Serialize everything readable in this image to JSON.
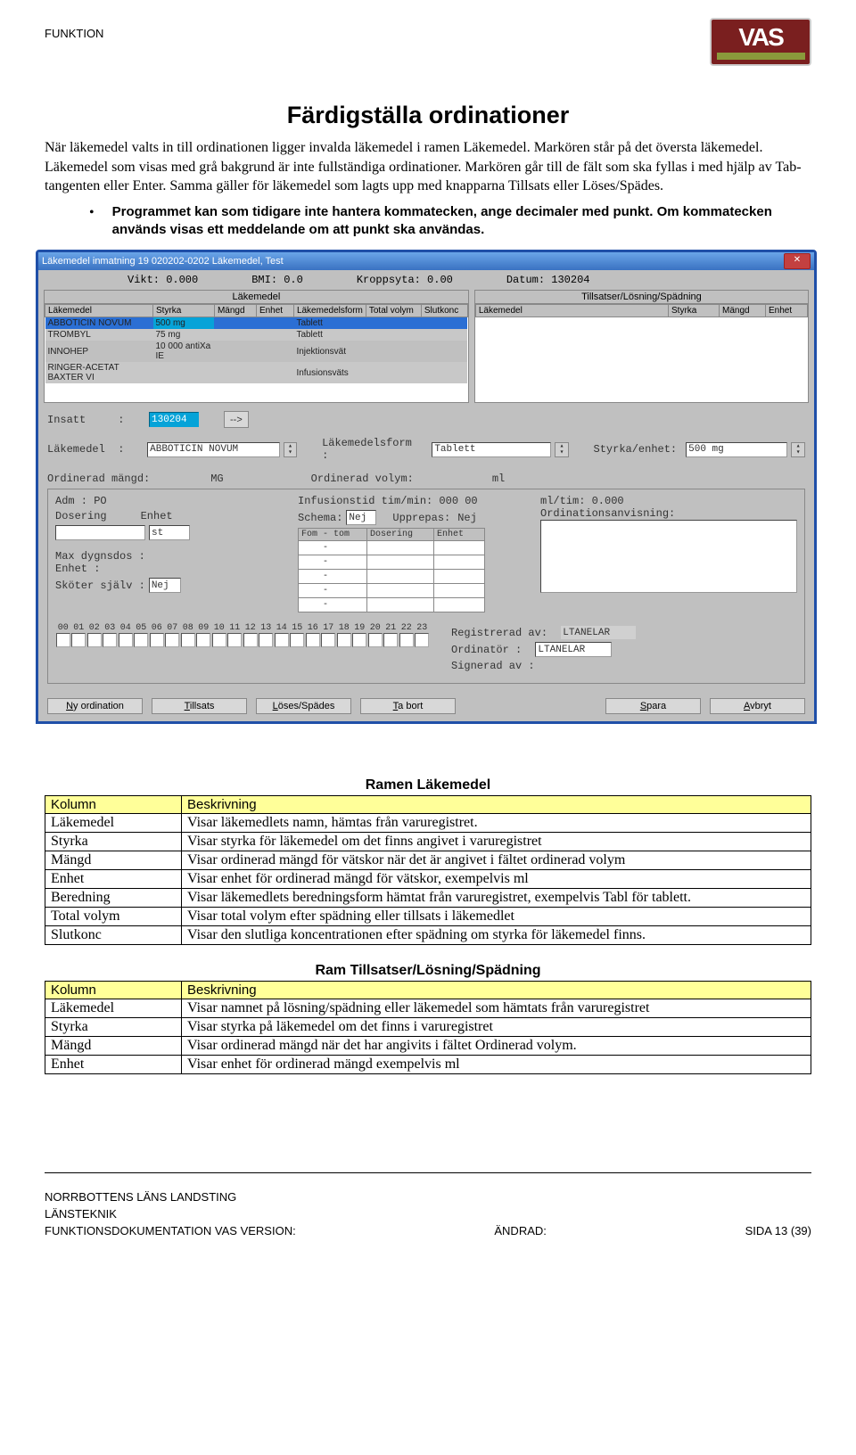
{
  "header": {
    "funktion": "FUNKTION",
    "logo_main": "VAS"
  },
  "title": "Färdigställa ordinationer",
  "intro": [
    "När läkemedel valts in till ordinationen ligger invalda läkemedel i ramen Läkemedel. Markören står på det översta läkemedel. Läkemedel som visas med grå bakgrund är inte fullständiga ordinationer. Markören går till de fält som ska fyllas i med hjälp av Tab-tangenten eller Enter. Samma gäller för läkemedel som lagts upp med knapparna Tillsats eller Löses/Spädes."
  ],
  "bullet": "Programmet kan som tidigare inte hantera kommatecken, ange decimaler med punkt. Om kommatecken används visas ett meddelande om att punkt ska användas.",
  "win": {
    "title": "Läkemedel inmatning  19 020202-0202  Läkemedel, Test",
    "status": {
      "vikt": "Vikt: 0.000",
      "bmi": "BMI: 0.0",
      "kropp": "Kroppsyta: 0.00",
      "datum": "Datum: 130204"
    },
    "pane_left_title": "Läkemedel",
    "pane_right_title": "Tillsatser/Lösning/Spädning",
    "cols_left": [
      "Läkemedel",
      "Styrka",
      "Mängd",
      "Enhet",
      "Läkemedelsform",
      "Total volym",
      "Slutkonc"
    ],
    "cols_right": [
      "Läkemedel",
      "Styrka",
      "Mängd",
      "Enhet"
    ],
    "rows": [
      {
        "n": "ABBOTICIN NOVUM",
        "s": "500 mg",
        "form": "Tablett",
        "sel": true
      },
      {
        "n": "TROMBYL",
        "s": "75 mg",
        "form": "Tablett"
      },
      {
        "n": "INNOHEP",
        "s": "10 000 antiXa IE",
        "form": "Injektionsvät"
      },
      {
        "n": "RINGER-ACETAT BAXTER VI",
        "s": "",
        "form": "Infusionsväts"
      }
    ],
    "form": {
      "insatt_lbl": "Insatt",
      "insatt_val": "130204",
      "arrow": "-->",
      "lakemedel_lbl": "Läkemedel",
      "lakemedel_val": "ABBOTICIN NOVUM",
      "lakform_lbl": "Läkemedelsform :",
      "lakform_val": "Tablett",
      "styrka_lbl": "Styrka/enhet:",
      "styrka_val": "500 mg",
      "ord_mangd_lbl": "Ordinerad mängd:",
      "mg": "MG",
      "ord_vol_lbl": "Ordinerad volym:",
      "ml": "ml",
      "adm": "Adm   : PO",
      "infustid": "Infusionstid tim/min: 000 00",
      "mltim": "ml/tim:    0.000",
      "dosering": "Dosering",
      "enhet": "Enhet",
      "st": "st",
      "schema": "Schema:",
      "nej": "Nej",
      "upprepas": "Upprepas:",
      "ordanv": "Ordinationsanvisning:",
      "fomtom": "Fom - tom",
      "dos": "Dosering",
      "enh": "Enhet",
      "maxd": "Max dygnsdos  :",
      "enhlbl": "Enhet         :",
      "skoter": "Sköter själv  :",
      "reg": "Registrerad av:",
      "reg_v": "LTANELAR",
      "ordb": "Ordinatör     :",
      "ord_v": "LTANELAR",
      "sig": "Signerad av   :"
    },
    "buttons": [
      "Ny ordination",
      "Tillsats",
      "Löses/Spädes",
      "Ta bort",
      "Spara",
      "Avbryt"
    ]
  },
  "table1": {
    "title": "Ramen Läkemedel",
    "head": [
      "Kolumn",
      "Beskrivning"
    ],
    "rows": [
      [
        "Läkemedel",
        "Visar läkemedlets namn, hämtas från varuregistret."
      ],
      [
        "Styrka",
        "Visar styrka för läkemedel om det finns angivet i varuregistret"
      ],
      [
        "Mängd",
        "Visar ordinerad mängd för vätskor när det är angivet i fältet ordinerad volym"
      ],
      [
        "Enhet",
        "Visar enhet för ordinerad mängd för vätskor, exempelvis ml"
      ],
      [
        "Beredning",
        "Visar läkemedlets beredningsform hämtat från varuregistret, exempelvis Tabl för tablett."
      ],
      [
        "Total volym",
        "Visar total volym efter spädning eller tillsats i läkemedlet"
      ],
      [
        "Slutkonc",
        "Visar den slutliga koncentrationen efter spädning om styrka för läkemedel finns."
      ]
    ]
  },
  "table2": {
    "title": "Ram Tillsatser/Lösning/Spädning",
    "head": [
      "Kolumn",
      "Beskrivning"
    ],
    "rows": [
      [
        "Läkemedel",
        "Visar namnet på lösning/spädning eller läkemedel som hämtats från varuregistret"
      ],
      [
        "Styrka",
        "Visar styrka på läkemedel om det finns i varuregistret"
      ],
      [
        "Mängd",
        "Visar ordinerad mängd när det har angivits i fältet Ordinerad volym."
      ],
      [
        "Enhet",
        "Visar enhet för ordinerad mängd exempelvis ml"
      ]
    ]
  },
  "footer": {
    "l1": "NORRBOTTENS LÄNS LANDSTING",
    "l2": "LÄNSTEKNIK",
    "l3": "FUNKTIONSDOKUMENTATION VAS VERSION:",
    "mid": "ÄNDRAD:",
    "right": "SIDA 13 (39)"
  }
}
